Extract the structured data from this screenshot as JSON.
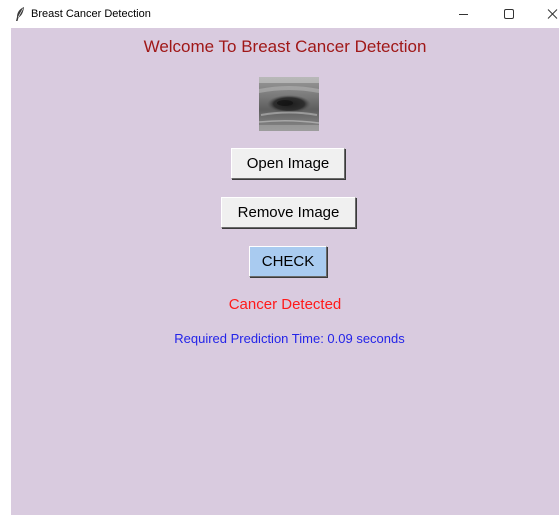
{
  "window": {
    "title": "Breast Cancer Detection",
    "icon": "feather-icon",
    "controls": {
      "minimize_icon": "minimize-icon",
      "maximize_icon": "maximize-icon",
      "close_icon": "close-icon"
    }
  },
  "main": {
    "heading": "Welcome To Breast Cancer Detection",
    "image_thumbnail": "ultrasound-image",
    "buttons": {
      "open_label": "Open Image",
      "remove_label": "Remove Image",
      "check_label": "CHECK"
    },
    "result_text": "Cancer Detected",
    "prediction_time_text": "Required Prediction Time: 0.09 seconds"
  },
  "colors": {
    "background": "#d9cbdf",
    "heading": "#a01818",
    "result": "#ff1a1a",
    "prediction_time": "#2424e8",
    "check_button": "#a9cbf0",
    "button": "#f0f0f0"
  }
}
